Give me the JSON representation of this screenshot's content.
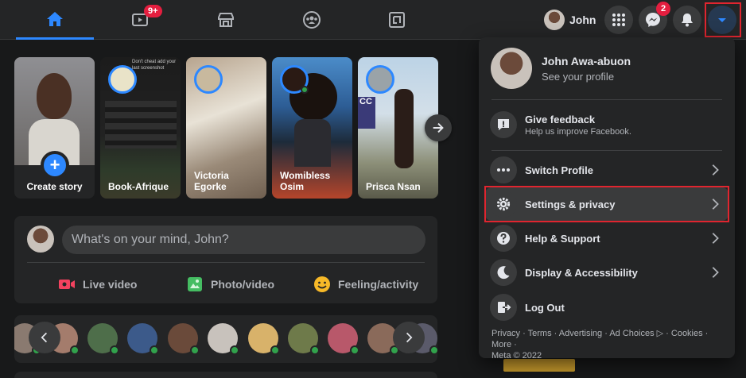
{
  "nav": {
    "tabs": [
      {
        "name": "home",
        "active": true
      },
      {
        "name": "watch",
        "badge": "9+"
      },
      {
        "name": "marketplace"
      },
      {
        "name": "groups"
      },
      {
        "name": "gaming"
      }
    ],
    "profile_name": "John",
    "messenger_badge": "2"
  },
  "stories": [
    {
      "label": "Create story"
    },
    {
      "label": "Book-Afrique",
      "overlay_text": "Don't cheat add your last screenshot"
    },
    {
      "label": "Victoria Egorke"
    },
    {
      "label": "Womibless Osim"
    },
    {
      "label": "Prisca Nsan"
    }
  ],
  "composer": {
    "placeholder": "What's on your mind, John?",
    "actions": [
      "Live video",
      "Photo/video",
      "Feeling/activity"
    ]
  },
  "menu": {
    "profile_name": "John Awa-abuon",
    "profile_sub": "See your profile",
    "feedback_title": "Give feedback",
    "feedback_sub": "Help us improve Facebook.",
    "items": [
      "Switch Profile",
      "Settings & privacy",
      "Help & Support",
      "Display & Accessibility",
      "Log Out"
    ],
    "footer_links": "Privacy · Terms · Advertising · Ad Choices ▷ · Cookies · More ·",
    "footer_copy": "Meta © 2022"
  },
  "colors": {
    "accent": "#2d88ff",
    "badge": "#e41e3f",
    "highlight": "#e0252f",
    "online": "#31a24c"
  }
}
